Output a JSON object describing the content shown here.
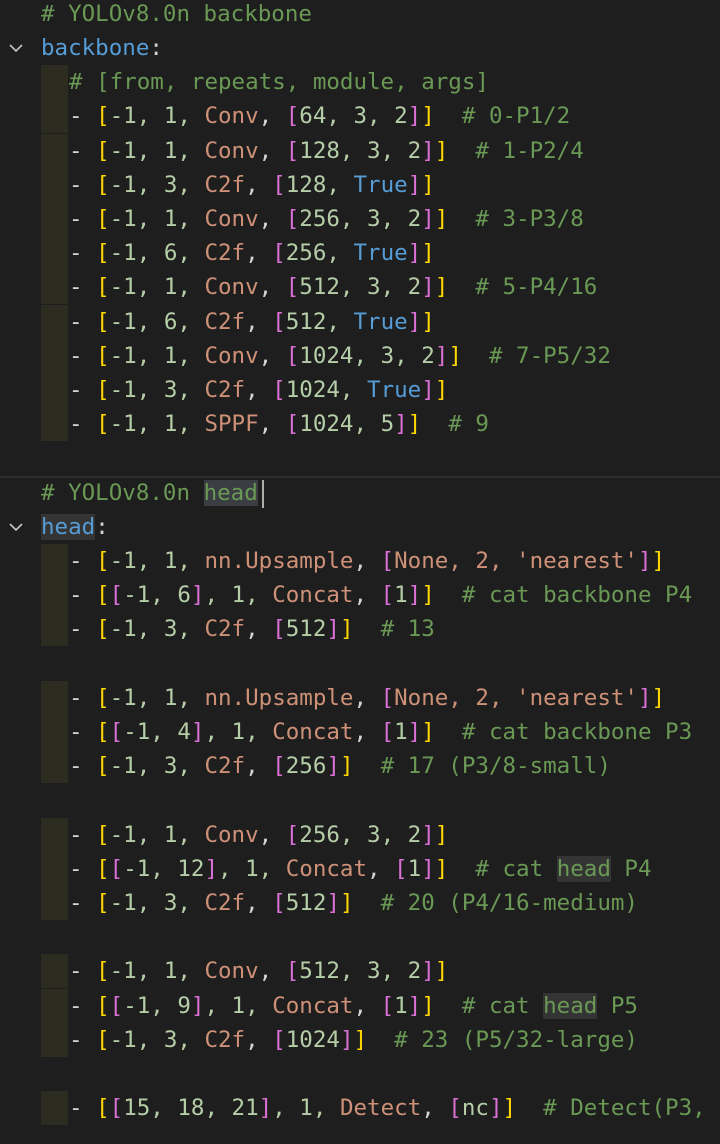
{
  "editor": {
    "fold_icon": "chevron-down-icon",
    "colors": {
      "background": "#1e1e1e",
      "comment": "#6a9955",
      "key": "#569cd6",
      "number": "#b5cea8",
      "module": "#ce9178",
      "bracket_1": "#ffd700",
      "bracket_2": "#da70d6",
      "bracket_3": "#179fff",
      "indent_guide": "#2c2c20"
    },
    "lines": {
      "backbone_title": "# YOLOv8.0n backbone",
      "backbone_key": "backbone",
      "args_comment": "# [from, repeats, module, args]",
      "bb0": {
        "nums": "-1, 1, ",
        "module": "Conv",
        "args": "64, 3, 2",
        "comment": "# 0-P1/2"
      },
      "bb1": {
        "nums": "-1, 1, ",
        "module": "Conv",
        "args": "128, 3, 2",
        "comment": "# 1-P2/4"
      },
      "bb2": {
        "nums": "-1, 3, ",
        "module": "C2f",
        "args": "128, ",
        "flag": "True"
      },
      "bb3": {
        "nums": "-1, 1, ",
        "module": "Conv",
        "args": "256, 3, 2",
        "comment": "# 3-P3/8"
      },
      "bb4": {
        "nums": "-1, 6, ",
        "module": "C2f",
        "args": "256, ",
        "flag": "True"
      },
      "bb5": {
        "nums": "-1, 1, ",
        "module": "Conv",
        "args": "512, 3, 2",
        "comment": "# 5-P4/16"
      },
      "bb6": {
        "nums": "-1, 6, ",
        "module": "C2f",
        "args": "512, ",
        "flag": "True"
      },
      "bb7": {
        "nums": "-1, 1, ",
        "module": "Conv",
        "args": "1024, 3, 2",
        "comment": "# 7-P5/32"
      },
      "bb8": {
        "nums": "-1, 3, ",
        "module": "C2f",
        "args": "1024, ",
        "flag": "True"
      },
      "bb9": {
        "nums": "-1, 1, ",
        "module": "SPPF",
        "args": "1024, 5",
        "comment": "# 9"
      },
      "head_title_prefix": "# YOLOv8.0n ",
      "head_title_word": "head",
      "head_key": "head",
      "h0": {
        "nums": "-1, 1, ",
        "module": "nn.Upsample",
        "args_a": "None, 2, ",
        "args_b": "'nearest'"
      },
      "h1": {
        "inner": "-1, 6",
        "nums": ", 1, ",
        "module": "Concat",
        "args": "1",
        "comment": "# cat backbone P4"
      },
      "h2": {
        "nums": "-1, 3, ",
        "module": "C2f",
        "args": "512",
        "comment": "# 13"
      },
      "h3": {
        "nums": "-1, 1, ",
        "module": "nn.Upsample",
        "args_a": "None, 2, ",
        "args_b": "'nearest'"
      },
      "h4": {
        "inner": "-1, 4",
        "nums": ", 1, ",
        "module": "Concat",
        "args": "1",
        "comment": "# cat backbone P3"
      },
      "h5": {
        "nums": "-1, 3, ",
        "module": "C2f",
        "args": "256",
        "comment": "# 17 (P3/8-small)"
      },
      "h6": {
        "nums": "-1, 1, ",
        "module": "Conv",
        "args": "256, 3, 2"
      },
      "h7": {
        "inner": "-1, 12",
        "nums": ", 1, ",
        "module": "Concat",
        "args": "1",
        "comment_a": "# cat ",
        "comment_hl": "head",
        "comment_b": " P4"
      },
      "h8": {
        "nums": "-1, 3, ",
        "module": "C2f",
        "args": "512",
        "comment": "# 20 (P4/16-medium)"
      },
      "h9": {
        "nums": "-1, 1, ",
        "module": "Conv",
        "args": "512, 3, 2"
      },
      "h10": {
        "inner": "-1, 9",
        "nums": ", 1, ",
        "module": "Concat",
        "args": "1",
        "comment_a": "# cat ",
        "comment_hl": "head",
        "comment_b": " P5"
      },
      "h11": {
        "nums": "-1, 3, ",
        "module": "C2f",
        "args": "1024",
        "comment": "# 23 (P5/32-large)"
      },
      "h12": {
        "inner": "15, 18, 21",
        "nums": ", 1, ",
        "module": "Detect",
        "args": "nc",
        "comment": "# Detect(P3,"
      }
    }
  }
}
